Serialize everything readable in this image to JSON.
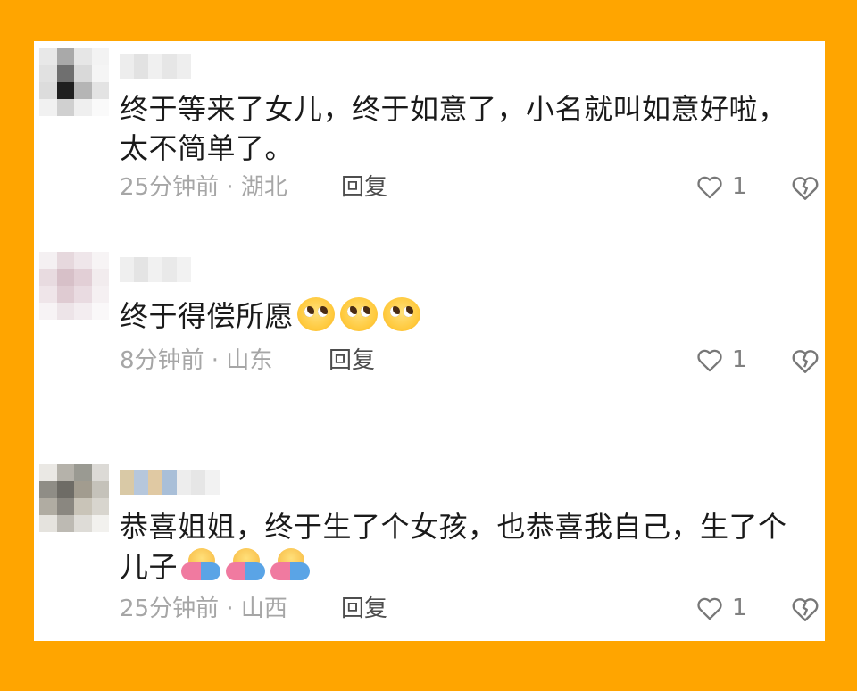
{
  "comments": [
    {
      "text": "终于等来了女儿，终于如意了，小名就叫如意好啦，太不简单了。",
      "time": "25分钟前",
      "location": "湖北",
      "reply_label": "回复",
      "likes": "1",
      "emoji": []
    },
    {
      "text": "终于得偿所愿",
      "time": "8分钟前",
      "location": "山东",
      "reply_label": "回复",
      "likes": "1",
      "emoji": [
        "pleading-face-emoji",
        "pleading-face-emoji",
        "pleading-face-emoji"
      ]
    },
    {
      "text": "恭喜姐姐，终于生了个女孩，也恭喜我自己，生了个儿子",
      "time": "25分钟前",
      "location": "山西",
      "reply_label": "回复",
      "likes": "1",
      "emoji": [
        "people-hugging-emoji",
        "people-hugging-emoji",
        "people-hugging-emoji"
      ]
    }
  ],
  "icons": {
    "like": "heart-outline-icon",
    "dislike": "broken-heart-outline-icon"
  },
  "colors": {
    "frame": "#ffa500",
    "text": "#1a1a1a",
    "meta": "#a6a6a6",
    "reply": "#4d4d4d"
  }
}
